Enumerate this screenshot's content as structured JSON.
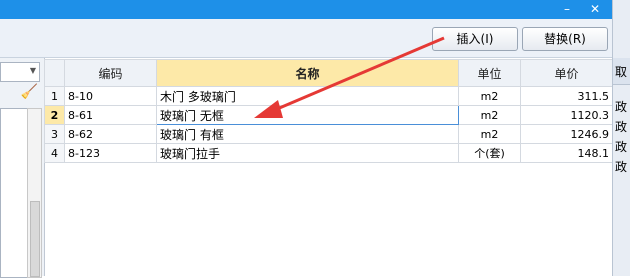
{
  "window": {
    "minimize_glyph": "–",
    "close_glyph": "✕"
  },
  "toolbar": {
    "insert_label": "插入(I)",
    "replace_label": "替换(R)"
  },
  "table": {
    "headers": [
      "",
      "编码",
      "名称",
      "单位",
      "单价"
    ],
    "rows": [
      {
        "index": "1",
        "code": "8-10",
        "name": "木门 多玻璃门",
        "unit": "m2",
        "price": "311.5"
      },
      {
        "index": "2",
        "code": "8-61",
        "name": "玻璃门 无框",
        "unit": "m2",
        "price": "1120.3"
      },
      {
        "index": "3",
        "code": "8-62",
        "name": "玻璃门 有框",
        "unit": "m2",
        "price": "1246.9"
      },
      {
        "index": "4",
        "code": "8-123",
        "name": "玻璃门拉手",
        "unit": "个(套)",
        "price": "148.1"
      }
    ]
  },
  "right_panel": {
    "header": "取",
    "items": [
      "政",
      "政",
      "政",
      "政"
    ]
  },
  "colors": {
    "titlebar": "#1e90e8",
    "selection": "#fde9a8",
    "arrow": "#e53935"
  }
}
